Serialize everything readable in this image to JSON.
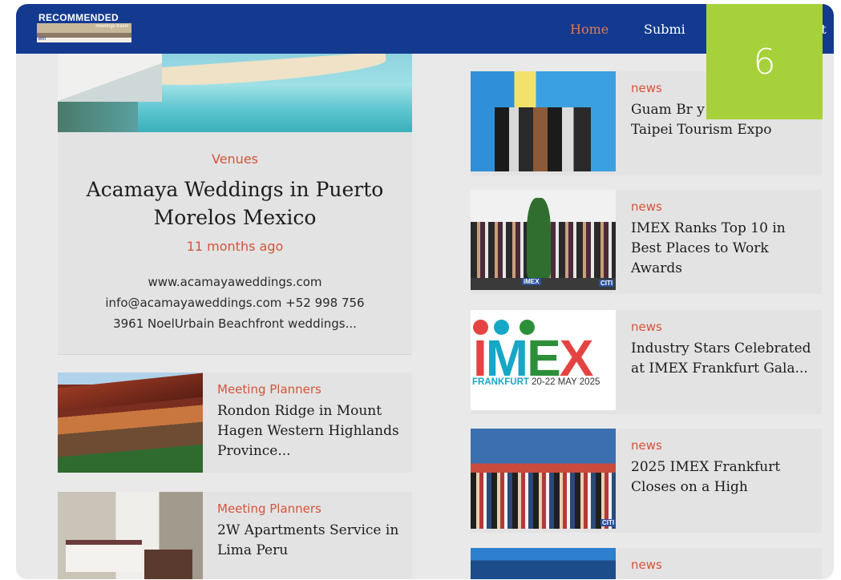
{
  "nav": {
    "logo_text": "RECOMMENDED",
    "logo_subtext": "meetings travel",
    "logo_corner": "win",
    "home": "Home",
    "submit_1": "Submi",
    "submit_2": "mit"
  },
  "slide_number": "6",
  "feature": {
    "category": "Venues",
    "title": "Acamaya Weddings in Puerto Morelos Mexico",
    "time": "11 months ago",
    "description": "www.acamayaweddings.com info@acamayaweddings.com +52 998 756 3961 NoelUrbain Beachfront weddings..."
  },
  "left_list": [
    {
      "category": "Meeting Planners",
      "title": "Rondon Ridge in Mount Hagen Western Highlands Province..."
    },
    {
      "category": "Meeting Planners",
      "title": "2W Apartments Service in Lima Peru"
    }
  ],
  "right_list": [
    {
      "category": "news",
      "title": "Guam Br        y         t to 2025 Taipei Tourism Expo"
    },
    {
      "category": "news",
      "title": "IMEX Ranks Top 10 in Best Places to Work Awards"
    },
    {
      "category": "news",
      "title": "Industry Stars Celebrated at IMEX Frankfurt Gala..."
    },
    {
      "category": "news",
      "title": "2025 IMEX Frankfurt Closes on a High"
    },
    {
      "category": "news",
      "title": ""
    }
  ],
  "imex_logo": {
    "word_i": "I",
    "word_m": "M",
    "word_e": "E",
    "word_x": "X",
    "city": "FRANKFURT",
    "dates": "20-22 MAY 2025"
  },
  "thumb_tags": {
    "imex_small": "iMEX",
    "corner": "CITI"
  },
  "colors": {
    "navbar": "#133a8f",
    "accent": "#d4533b",
    "badge": "#a6d13a",
    "imex_red": "#e54343",
    "imex_blue": "#16a7c7",
    "imex_green": "#2d8f3a"
  }
}
